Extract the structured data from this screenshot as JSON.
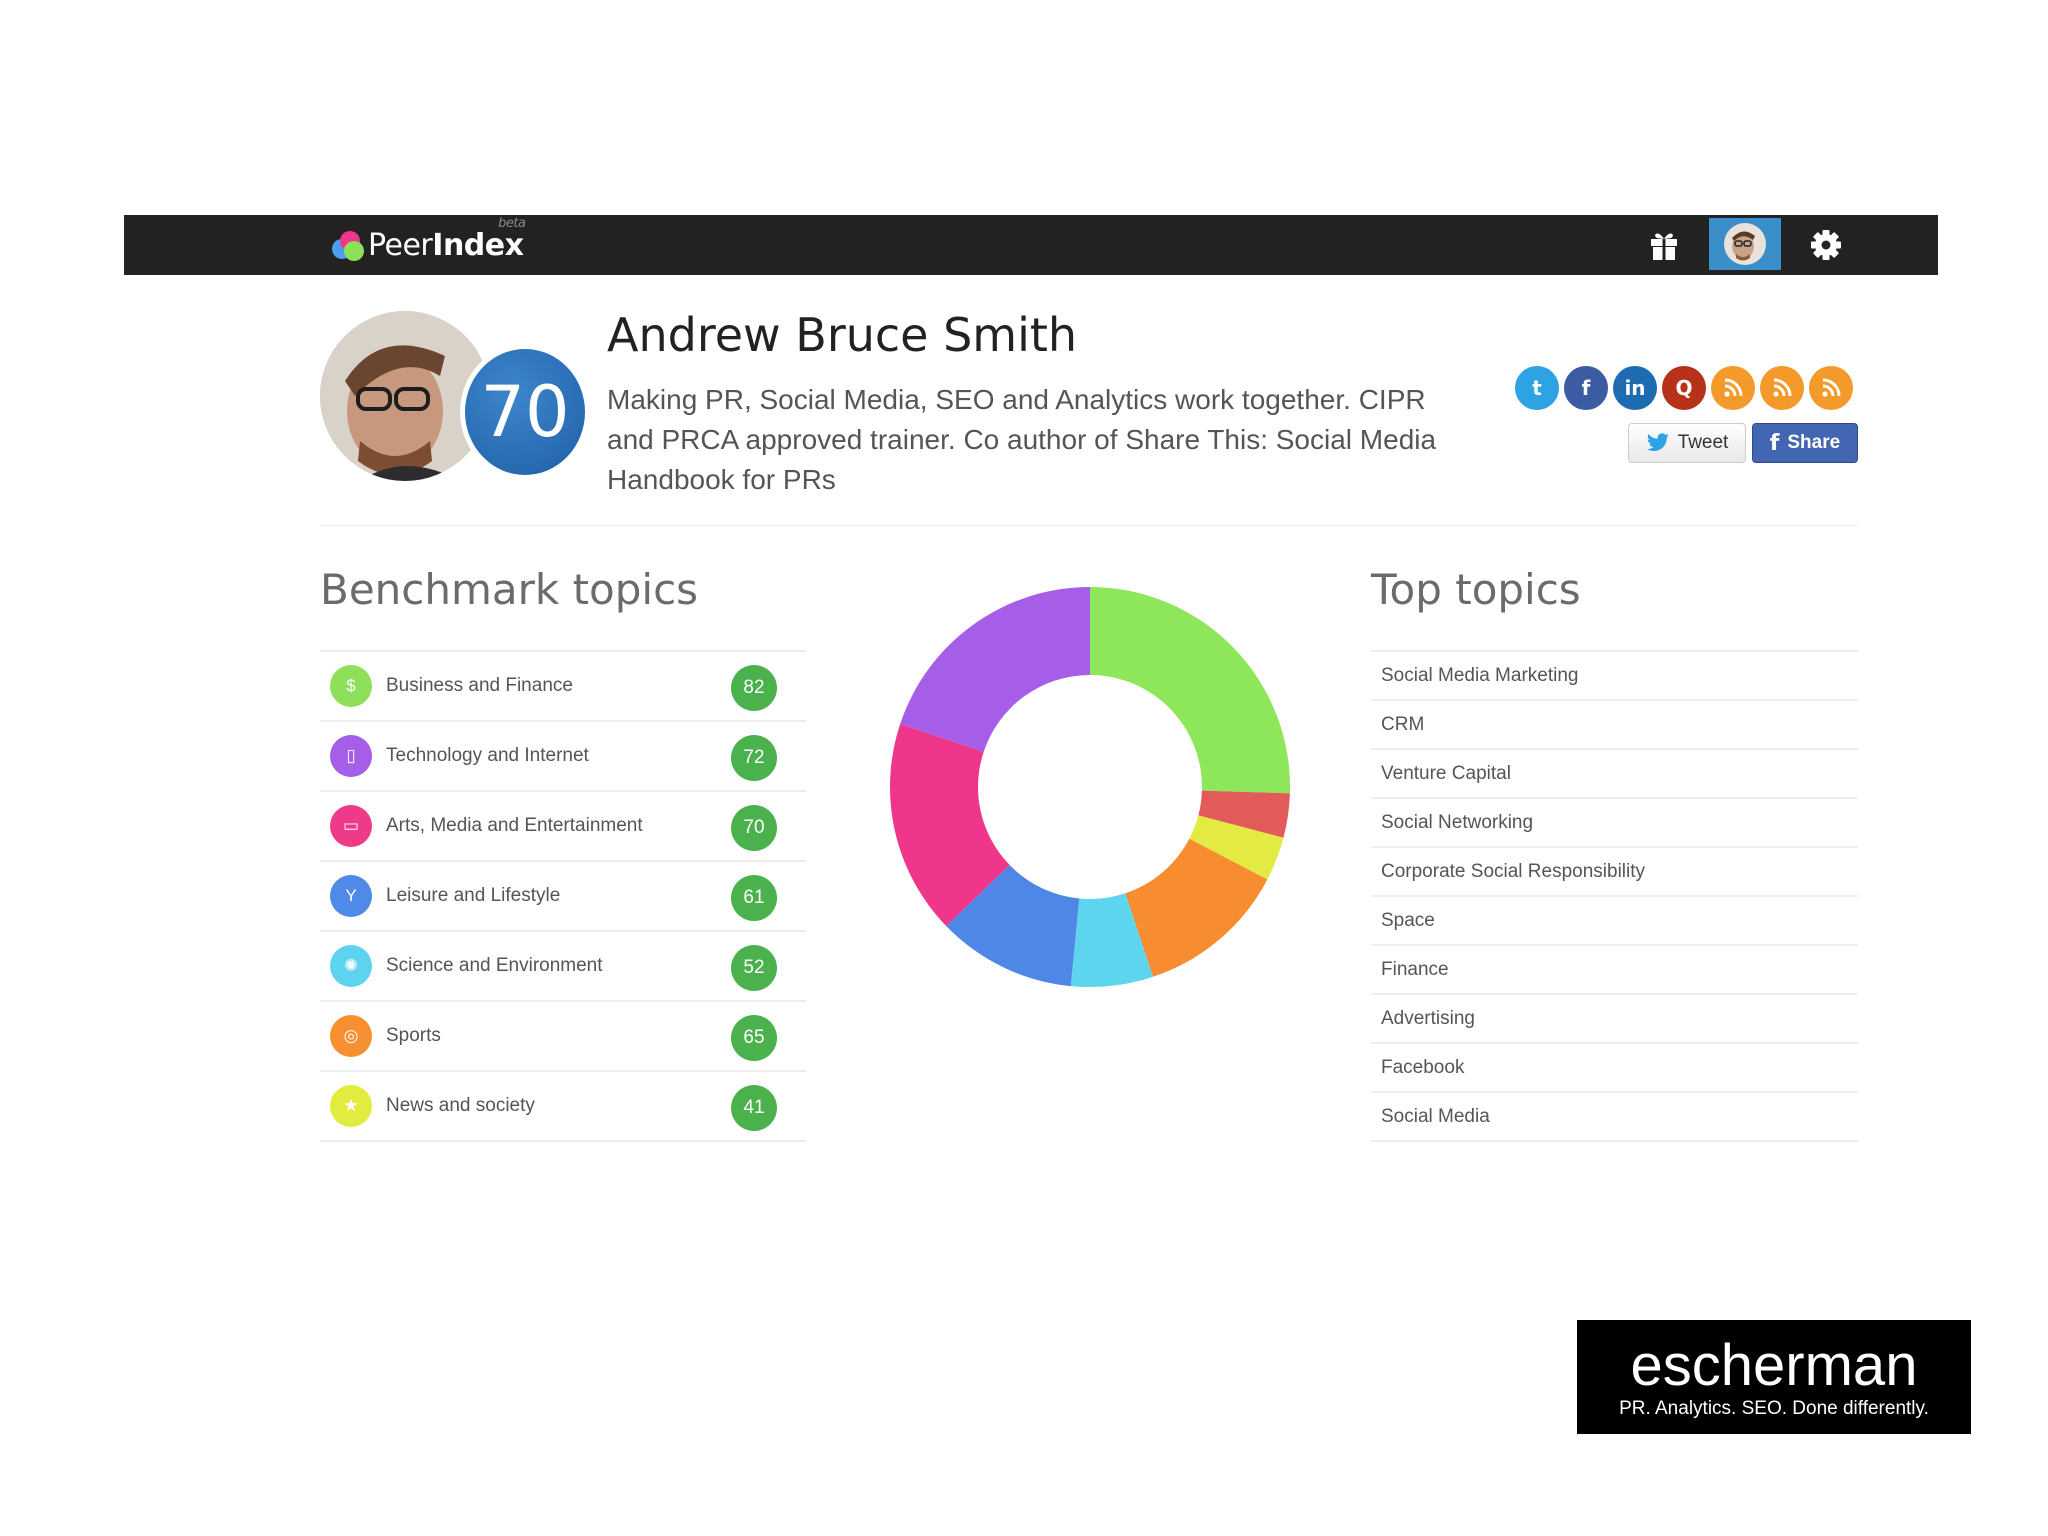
{
  "navbar": {
    "logo": {
      "text_regular": "Peer",
      "text_bold": "Index",
      "badge": "beta"
    }
  },
  "profile": {
    "name": "Andrew Bruce Smith",
    "score": "70",
    "bio": "Making PR, Social Media, SEO and Analytics work together. CIPR and PRCA approved trainer. Co author of Share This: Social Media Handbook for PRs"
  },
  "social": {
    "icons": [
      {
        "name": "twitter-icon",
        "color": "#2ea3e3",
        "glyph": "t"
      },
      {
        "name": "facebook-icon",
        "color": "#3b5ba2",
        "glyph": "f"
      },
      {
        "name": "linkedin-icon",
        "color": "#1d6bb0",
        "glyph": "in"
      },
      {
        "name": "quora-icon",
        "color": "#b8321a",
        "glyph": "Q"
      },
      {
        "name": "rss-icon",
        "color": "#f39a2a",
        "glyph": "rss"
      },
      {
        "name": "rss-icon",
        "color": "#f39a2a",
        "glyph": "rss"
      },
      {
        "name": "rss-icon",
        "color": "#f39a2a",
        "glyph": "rss"
      }
    ],
    "tweet_label": "Tweet",
    "share_label": "Share"
  },
  "benchmark": {
    "title": "Benchmark topics",
    "items": [
      {
        "label": "Business and Finance",
        "score": "82",
        "color": "#8ee05a",
        "icon": "dollar-icon",
        "glyph": "$"
      },
      {
        "label": "Technology and Internet",
        "score": "72",
        "color": "#a45ee8",
        "icon": "phone-icon",
        "glyph": "▯"
      },
      {
        "label": "Arts, Media and Entertainment",
        "score": "70",
        "color": "#ef3a8a",
        "icon": "monitor-icon",
        "glyph": "▭"
      },
      {
        "label": "Leisure and Lifestyle",
        "score": "61",
        "color": "#4f8ae8",
        "icon": "glass-icon",
        "glyph": "Y"
      },
      {
        "label": "Science and Environment",
        "score": "52",
        "color": "#5ed3ef",
        "icon": "atom-icon",
        "glyph": "✺"
      },
      {
        "label": "Sports",
        "score": "65",
        "color": "#f79030",
        "icon": "ball-icon",
        "glyph": "◎"
      },
      {
        "label": "News and society",
        "score": "41",
        "color": "#e2ec3e",
        "icon": "star-icon",
        "glyph": "★"
      }
    ]
  },
  "chart_data": {
    "type": "pie",
    "style": "donut",
    "slices": [
      {
        "label": "Business and Finance",
        "value": 25,
        "color": "#8ee65a"
      },
      {
        "label": "News and society (red)",
        "value": 3.5,
        "color": "#e35a5a"
      },
      {
        "label": "News and society",
        "value": 3.5,
        "color": "#e3ea42"
      },
      {
        "label": "Sports",
        "value": 12,
        "color": "#f78c30"
      },
      {
        "label": "Science and Environment",
        "value": 6.5,
        "color": "#5ed5ef"
      },
      {
        "label": "Leisure and Lifestyle",
        "value": 11,
        "color": "#4f87e6"
      },
      {
        "label": "Arts, Media and Entertainment",
        "value": 17,
        "color": "#f0368a"
      },
      {
        "label": "Technology and Internet",
        "value": 19.5,
        "color": "#a65ee8"
      }
    ]
  },
  "top_topics": {
    "title": "Top topics",
    "items": [
      "Social Media Marketing",
      "CRM",
      "Venture Capital",
      "Social Networking",
      "Corporate Social Responsibility",
      "Space",
      "Finance",
      "Advertising",
      "Facebook",
      "Social Media"
    ]
  },
  "branding": {
    "name": "escherman",
    "tagline": "PR. Analytics. SEO. Done differently."
  }
}
